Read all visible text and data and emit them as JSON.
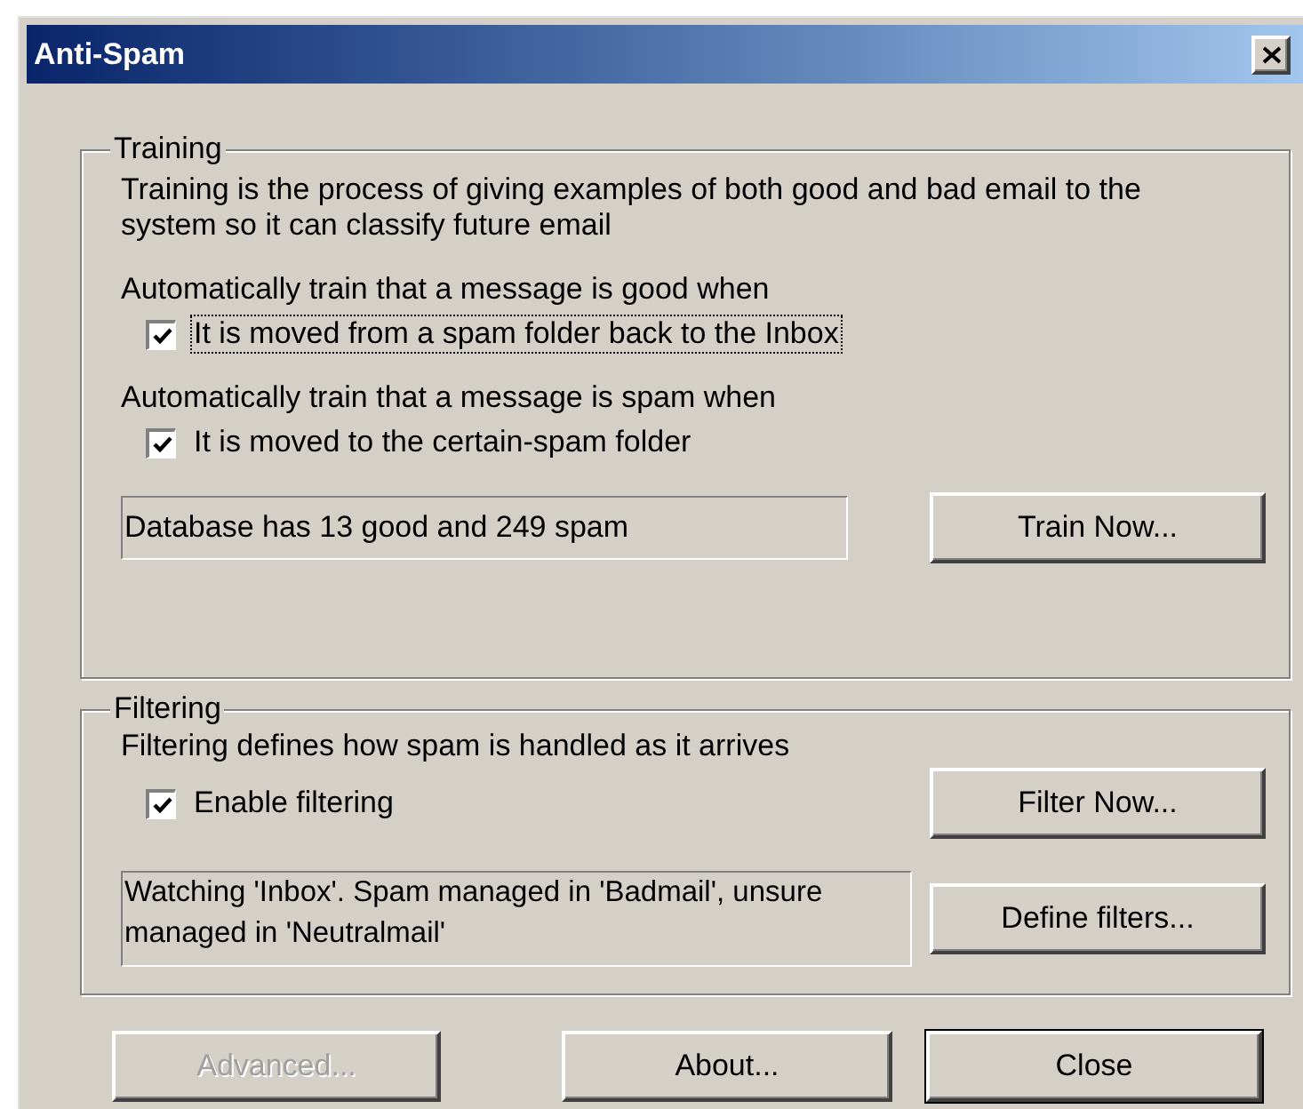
{
  "window": {
    "title": "Anti-Spam"
  },
  "training": {
    "legend": "Training",
    "description": "Training is the process of giving examples of both good and bad email to the system so it can classify future email",
    "rules": [
      {
        "heading": "Automatically train that a message is good when",
        "option": {
          "label": "It is moved from a spam folder back to the Inbox",
          "checked": true,
          "focused": true
        }
      },
      {
        "heading": "Automatically train that a message is spam when",
        "option": {
          "label": "It is moved to the certain-spam folder",
          "checked": true,
          "focused": false
        }
      }
    ],
    "status": "Database has 13 good and 249 spam",
    "button": "Train Now..."
  },
  "filtering": {
    "legend": "Filtering",
    "description": "Filtering defines how spam is handled as it arrives",
    "option": {
      "label": "Enable filtering",
      "checked": true,
      "focused": false
    },
    "status": "Watching 'Inbox'. Spam managed in 'Badmail', unsure managed in 'Neutralmail'",
    "buttons": [
      "Filter Now...",
      "Define filters..."
    ]
  },
  "buttons": [
    {
      "label": "Advanced...",
      "disabled": true,
      "default": false
    },
    {
      "label": "About...",
      "disabled": false,
      "default": false
    },
    {
      "label": "Close",
      "disabled": false,
      "default": true
    }
  ]
}
